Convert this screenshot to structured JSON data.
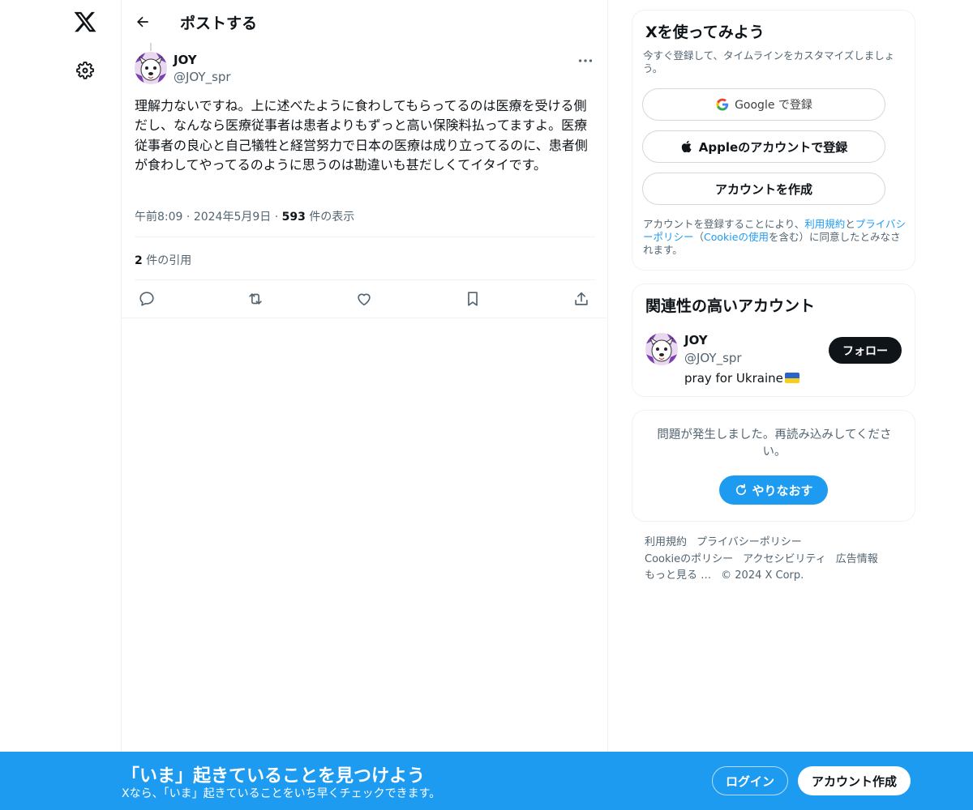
{
  "nav": {
    "logo_icon": "x-logo-icon",
    "settings_icon": "gear-icon"
  },
  "header": {
    "title": "ポストする"
  },
  "post": {
    "author_name": "JOY",
    "author_handle": "@JOY_spr",
    "text": "理解力ないですね。上に述べたように食わしてもらってるのは医療を受ける側だし、なんなら医療従事者は患者よりもずっと高い保険料払ってますよ。医療従事者の良心と自己犠牲と経営努力で日本の医療は成り立ってるのに、患者側が食わしてやってるのように思うのは勘違いも甚だしくてイタイです。",
    "time": "午前8:09",
    "date": "2024年5月9日",
    "views_count": "593",
    "views_label": "件の表示",
    "quotes_count": "2",
    "quotes_label": "件の引用"
  },
  "signup_card": {
    "title": "Xを使ってみよう",
    "subtitle": "今すぐ登録して、タイムラインをカスタマイズしましょう。",
    "google_label": "Google で登録",
    "apple_label": "Appleのアカウントで登録",
    "create_label": "アカウントを作成",
    "terms_prefix": "アカウントを登録することにより、",
    "terms_link": "利用規約",
    "terms_and": "と",
    "privacy_link": "プライバシーポリシー",
    "cookie_open": "（",
    "cookie_link": "Cookieの使用",
    "terms_suffix": "を含む）に同意したとみなされます。"
  },
  "related": {
    "title": "関連性の高いアカウント",
    "name": "JOY",
    "handle": "@JOY_spr",
    "bio": "pray for Ukraine",
    "follow_label": "フォロー"
  },
  "error_card": {
    "message": "問題が発生しました。再読み込みしてください。",
    "retry_label": "やりなおす"
  },
  "footer": {
    "links": [
      "利用規約",
      "プライバシーポリシー",
      "Cookieのポリシー",
      "アクセシビリティ",
      "広告情報",
      "もっと見る …"
    ],
    "copyright": "© 2024 X Corp."
  },
  "bottom_bar": {
    "title": "「いま」起きていることを見つけよう",
    "subtitle": "Xなら、「いま」起きていることをいち早くチェックできます。",
    "login_label": "ログイン",
    "signup_label": "アカウント作成"
  },
  "colors": {
    "accent": "#1d9bf0",
    "text": "#0f1419",
    "muted": "#536471",
    "border": "#eff3f4"
  }
}
